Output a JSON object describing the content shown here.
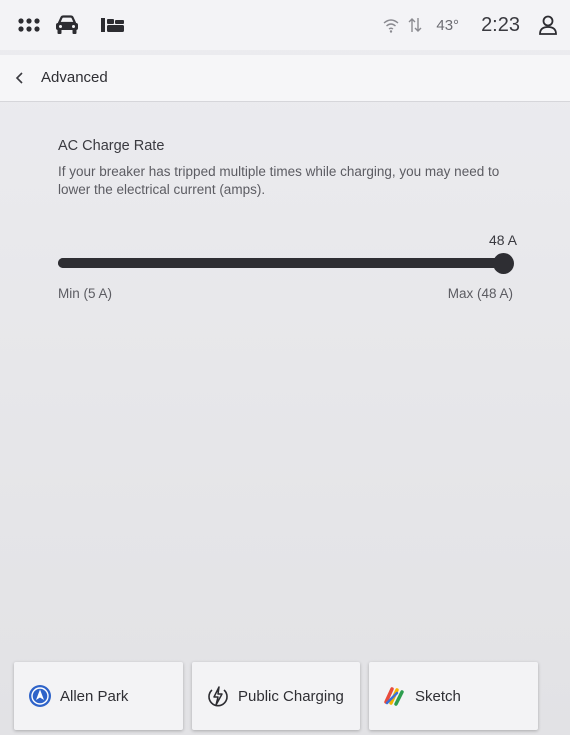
{
  "status_bar": {
    "left_icons": [
      "apps-grid-icon",
      "car-icon",
      "seat-icon"
    ],
    "right_icons": [
      "wifi-icon",
      "data-transfer-icon"
    ],
    "temperature": "43°",
    "time": "2:23",
    "profile_icon": "user-profile-icon"
  },
  "nav": {
    "back_icon": "chevron-left-icon",
    "title": "Advanced"
  },
  "charge_rate": {
    "title": "AC Charge Rate",
    "description": "If your breaker has tripped multiple times while charging, you may need to lower the electrical current (amps).",
    "value_label": "48 A",
    "min": 5,
    "max": 48,
    "value": 48,
    "min_label": "Min (5 A)",
    "max_label": "Max (48 A)"
  },
  "dock": {
    "items": [
      {
        "label": "Allen Park",
        "icon": "navigation-icon"
      },
      {
        "label": "Public Charging",
        "icon": "charging-bolt-icon"
      },
      {
        "label": "Sketch",
        "icon": "sketch-app-icon"
      }
    ]
  },
  "colors": {
    "slider": "#2e2e33",
    "nav_blue": "#2e63c9"
  }
}
